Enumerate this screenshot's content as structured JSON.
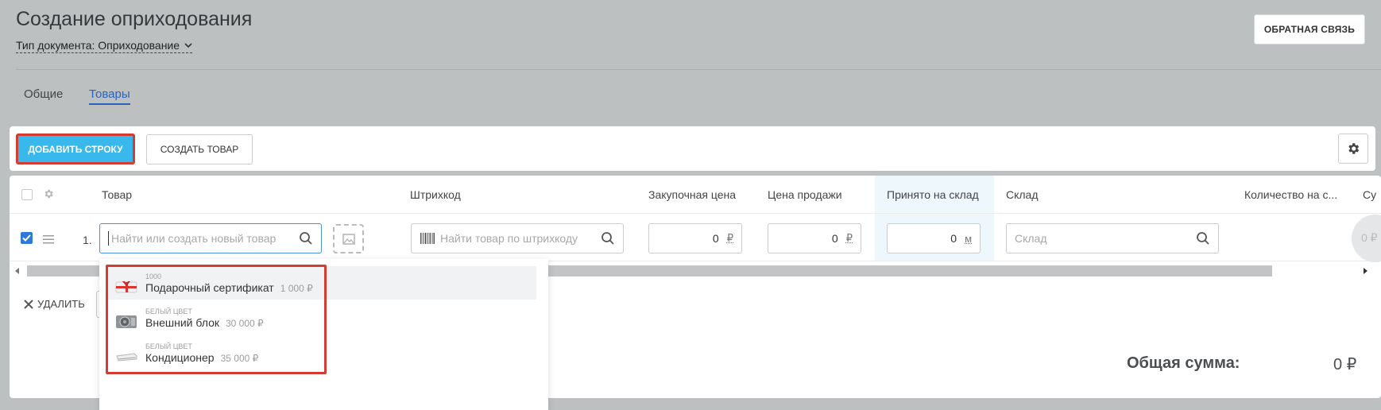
{
  "header": {
    "title": "Создание оприходования",
    "doc_type": "Тип документа: Оприходование",
    "feedback_label": "ОБРАТНАЯ СВЯЗЬ"
  },
  "tabs": [
    {
      "label": "Общие",
      "active": false
    },
    {
      "label": "Товары",
      "active": true
    }
  ],
  "toolbar": {
    "add_row_label": "ДОБАВИТЬ СТРОКУ",
    "create_goods_label": "СОЗДАТЬ ТОВАР"
  },
  "table": {
    "columns": [
      "Товар",
      "Штрихкод",
      "Закупочная цена",
      "Цена продажи",
      "Принято на склад",
      "Склад",
      "Количество на с...",
      "Су"
    ],
    "row": {
      "number": "1.",
      "checked": true,
      "product_placeholder": "Найти или создать новый товар",
      "barcode_placeholder": "Найти товар по штрихкоду",
      "purchase_price": "0",
      "purchase_currency": "₽",
      "sale_price": "0",
      "sale_currency": "₽",
      "accepted_qty": "0",
      "accepted_unit": "м",
      "warehouse_placeholder": "Склад",
      "edge_text": "0 ₽"
    }
  },
  "dropdown": {
    "items": [
      {
        "variant": "1000",
        "name": "Подарочный сертификат",
        "price": "1 000 ₽"
      },
      {
        "variant": "белый цвет",
        "name": "Внешний блок",
        "price": "30 000 ₽"
      },
      {
        "variant": "белый цвет",
        "name": "Кондиционер",
        "price": "35 000 ₽"
      }
    ]
  },
  "footer": {
    "delete_label": "УДАЛИТЬ",
    "total_label": "Общая сумма:",
    "total_value": "0 ₽"
  },
  "colors": {
    "accent": "#39b8eb",
    "highlight_border": "#d23c32",
    "link": "#2a63b8"
  }
}
